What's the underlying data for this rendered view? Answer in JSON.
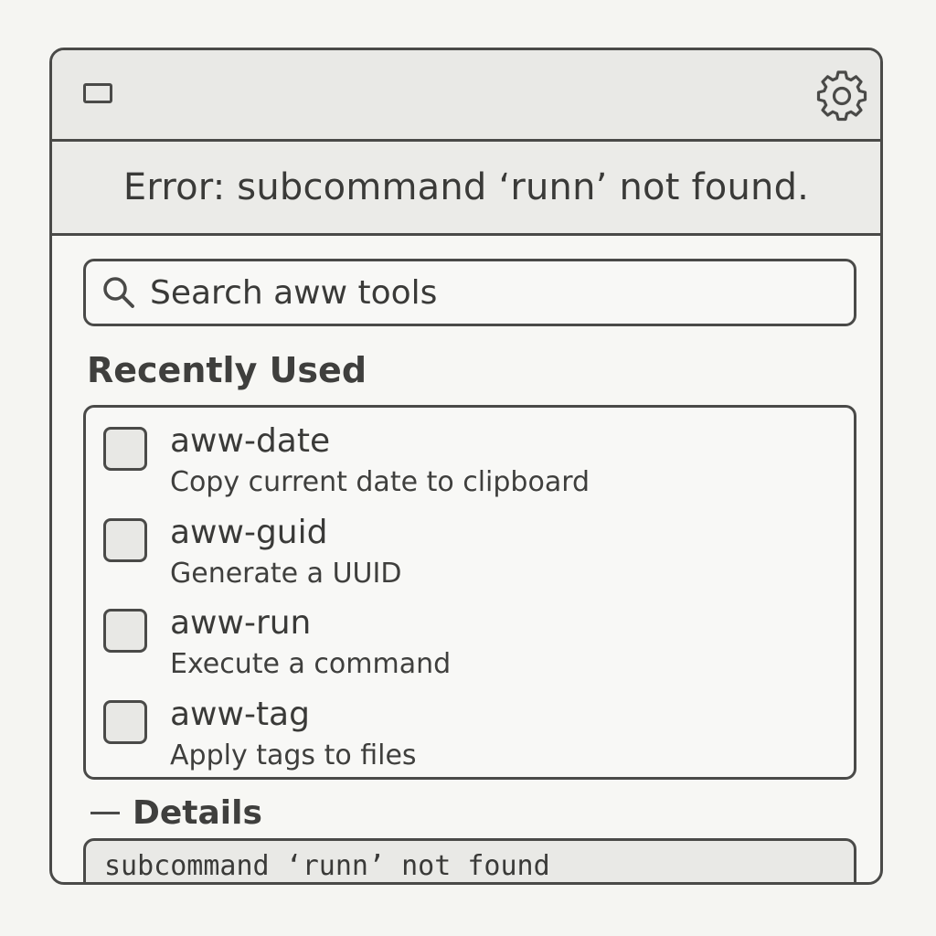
{
  "titlebar": {
    "window_icon": "window-icon",
    "settings_icon": "gear-icon"
  },
  "error": {
    "message": "Error: subcommand ‘runn’ not found."
  },
  "search": {
    "icon": "search-icon",
    "placeholder": "Search aww tools",
    "value": ""
  },
  "recent": {
    "title": "Recently Used",
    "items": [
      {
        "name": "aww-date",
        "description": "Copy current date to clipboard",
        "checked": false
      },
      {
        "name": "aww-guid",
        "description": "Generate a UUID",
        "checked": false
      },
      {
        "name": "aww-run",
        "description": "Execute a command",
        "checked": false
      },
      {
        "name": "aww-tag",
        "description": "Apply tags to files",
        "checked": false
      }
    ]
  },
  "details": {
    "toggle_icon": "collapse-dash-icon",
    "label": "Details",
    "text": "subcommand ‘runn’ not found"
  },
  "colors": {
    "background": "#f5f5f2",
    "border": "#4a4a48",
    "text": "#3a3a38",
    "titlebar": "#e9e9e6"
  }
}
